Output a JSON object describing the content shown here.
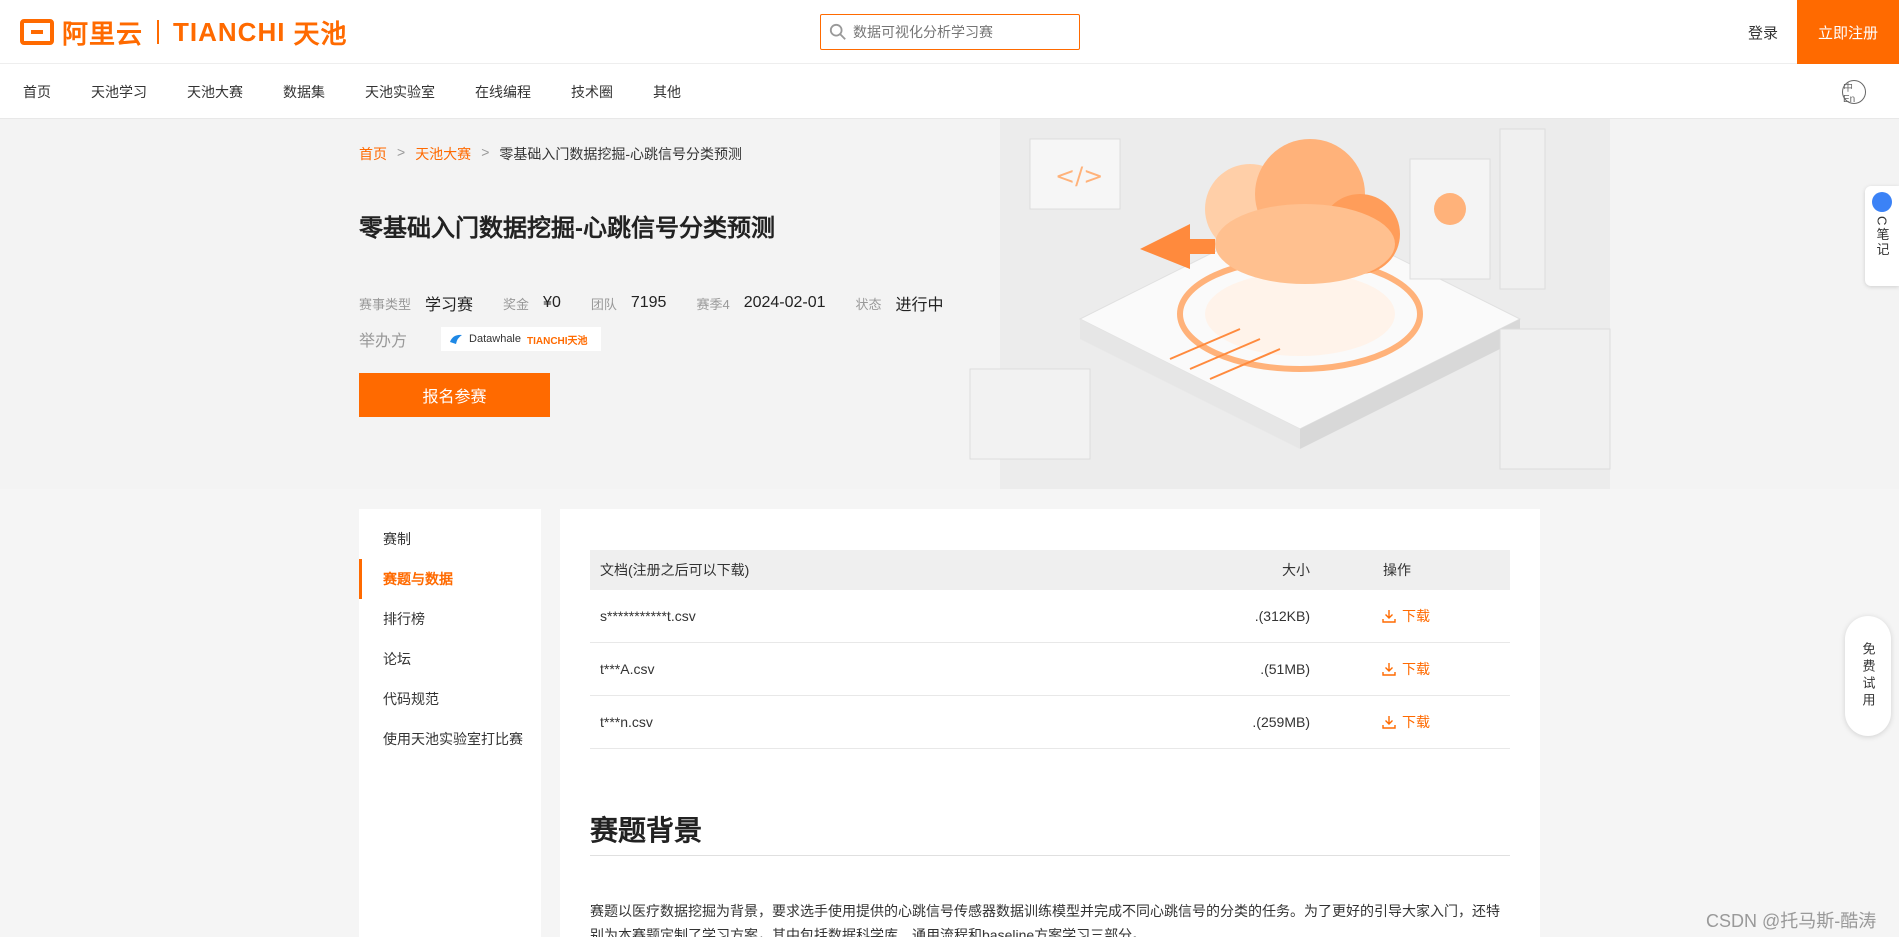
{
  "header": {
    "brand_cn": "阿里云",
    "brand_en": "TIANCHI",
    "brand_tianchi_cn": "天池",
    "search_placeholder": "数据可视化分析学习赛",
    "login": "登录",
    "register": "立即注册",
    "lang_toggle": "中En"
  },
  "nav": {
    "items": [
      "首页",
      "天池学习",
      "天池大赛",
      "数据集",
      "天池实验室",
      "在线编程",
      "技术圈",
      "其他"
    ]
  },
  "breadcrumb": {
    "home": "首页",
    "competitions": "天池大赛",
    "current": "零基础入门数据挖掘-心跳信号分类预测",
    "sep": ">"
  },
  "hero": {
    "title": "零基础入门数据挖掘-心跳信号分类预测",
    "meta": [
      {
        "label": "赛事类型",
        "value": "学习赛"
      },
      {
        "label": "奖金",
        "value": "¥0"
      },
      {
        "label": "团队",
        "value": "7195"
      },
      {
        "label": "赛季4",
        "value": "2024-02-01"
      },
      {
        "label": "状态",
        "value": "进行中"
      }
    ],
    "organizer_label": "举办方",
    "organizer_logo_text": "Datawhale",
    "organizer_logo_text2": "TIANCHI天池",
    "join_button": "报名参赛"
  },
  "sidebar": {
    "items": [
      {
        "label": "赛制",
        "active": false
      },
      {
        "label": "赛题与数据",
        "active": true
      },
      {
        "label": "排行榜",
        "active": false
      },
      {
        "label": "论坛",
        "active": false
      },
      {
        "label": "代码规范",
        "active": false
      },
      {
        "label": "使用天池实验室打比赛",
        "active": false
      }
    ]
  },
  "files_table": {
    "headers": {
      "name": "文档(注册之后可以下载)",
      "size": "大小",
      "op": "操作"
    },
    "rows": [
      {
        "name": "s***********t.csv",
        "size": ".(312KB)",
        "op": "下载"
      },
      {
        "name": "t***A.csv",
        "size": ".(51MB)",
        "op": "下载"
      },
      {
        "name": "t***n.csv",
        "size": ".(259MB)",
        "op": "下载"
      }
    ]
  },
  "section": {
    "title": "赛题背景",
    "text": "赛题以医疗数据挖掘为背景，要求选手使用提供的心跳信号传感器数据训练模型并完成不同心跳信号的分类的任务。为了更好的引导大家入门，还特别为本赛题定制了学习方案，其中包括数据科学库、通用流程和baseline方案学习三部分。"
  },
  "floating": {
    "note": "C笔记",
    "trial": "免费试用"
  },
  "watermark": "CSDN @托马斯-酷涛",
  "colors": {
    "accent": "#ff6a00"
  }
}
